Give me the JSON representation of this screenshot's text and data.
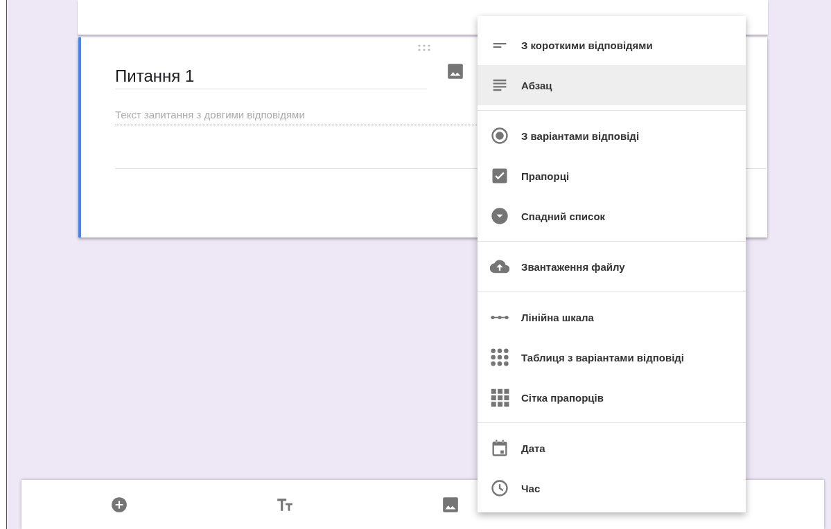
{
  "question": {
    "title": "Питання 1",
    "placeholder": "Текст запитання з довгими відповідями"
  },
  "type_menu": {
    "sections": [
      [
        {
          "kind": "short",
          "label": "З короткими відповідями",
          "selected": false
        },
        {
          "kind": "paragraph",
          "label": "Абзац",
          "selected": true
        }
      ],
      [
        {
          "kind": "radio",
          "label": "З варіантами відповіді",
          "selected": false
        },
        {
          "kind": "checkbox",
          "label": "Прапорці",
          "selected": false
        },
        {
          "kind": "dropdown",
          "label": "Спадний список",
          "selected": false
        }
      ],
      [
        {
          "kind": "upload",
          "label": "Звантаження файлу",
          "selected": false
        }
      ],
      [
        {
          "kind": "scale",
          "label": "Лінійна шкала",
          "selected": false
        },
        {
          "kind": "grid",
          "label": "Таблиця з варіантами відповіді",
          "selected": false
        },
        {
          "kind": "checkgrid",
          "label": "Сітка прапорців",
          "selected": false
        }
      ],
      [
        {
          "kind": "date",
          "label": "Дата",
          "selected": false
        },
        {
          "kind": "time",
          "label": "Час",
          "selected": false
        }
      ]
    ]
  },
  "toolbar": [
    {
      "kind": "add"
    },
    {
      "kind": "title"
    },
    {
      "kind": "image"
    }
  ]
}
